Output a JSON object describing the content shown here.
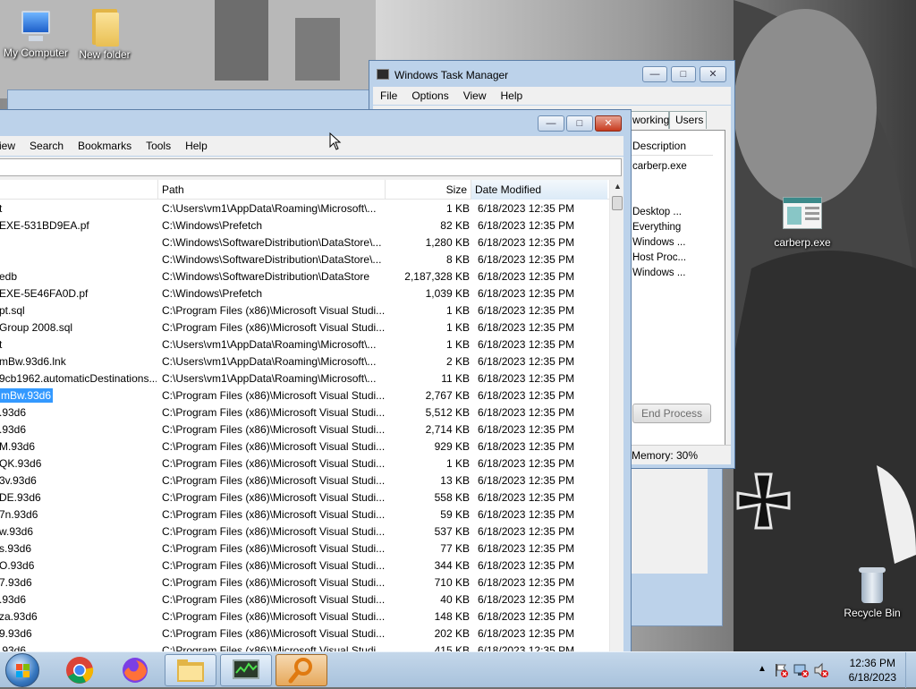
{
  "desktop": {
    "icons": [
      {
        "label": "My Computer",
        "icon": "computer-icon"
      },
      {
        "label": "New folder",
        "icon": "folder-icon"
      },
      {
        "label": "carberp.exe",
        "icon": "app-file-icon"
      },
      {
        "label": "Recycle Bin",
        "icon": "recycle-bin-icon"
      }
    ]
  },
  "taskmgr": {
    "title": "Windows Task Manager",
    "menu": [
      "File",
      "Options",
      "View",
      "Help"
    ],
    "tabs": [
      "working",
      "Users"
    ],
    "column_header": "Description",
    "processes": [
      "carberp.exe",
      "Desktop ...",
      "Everything",
      "Windows ...",
      "Host Proc...",
      "Windows ..."
    ],
    "end_process": "End Process",
    "status": "Memory: 30%"
  },
  "everything": {
    "menu": [
      "iew",
      "Search",
      "Bookmarks",
      "Tools",
      "Help"
    ],
    "search_value": "",
    "columns": {
      "path": "Path",
      "size": "Size",
      "date": "Date Modified"
    },
    "rows": [
      {
        "name": "t",
        "path": "C:\\Users\\vm1\\AppData\\Roaming\\Microsoft\\...",
        "size": "1 KB",
        "date": "6/18/2023 12:35 PM"
      },
      {
        "name": "EXE-531BD9EA.pf",
        "path": "C:\\Windows\\Prefetch",
        "size": "82 KB",
        "date": "6/18/2023 12:35 PM"
      },
      {
        "name": "",
        "path": "C:\\Windows\\SoftwareDistribution\\DataStore\\...",
        "size": "1,280 KB",
        "date": "6/18/2023 12:35 PM"
      },
      {
        "name": "",
        "path": "C:\\Windows\\SoftwareDistribution\\DataStore\\...",
        "size": "8 KB",
        "date": "6/18/2023 12:35 PM"
      },
      {
        "name": "edb",
        "path": "C:\\Windows\\SoftwareDistribution\\DataStore",
        "size": "2,187,328 KB",
        "date": "6/18/2023 12:35 PM"
      },
      {
        "name": "EXE-5E46FA0D.pf",
        "path": "C:\\Windows\\Prefetch",
        "size": "1,039 KB",
        "date": "6/18/2023 12:35 PM"
      },
      {
        "name": "pt.sql",
        "path": "C:\\Program Files (x86)\\Microsoft Visual Studi...",
        "size": "1 KB",
        "date": "6/18/2023 12:35 PM"
      },
      {
        "name": "Group 2008.sql",
        "path": "C:\\Program Files (x86)\\Microsoft Visual Studi...",
        "size": "1 KB",
        "date": "6/18/2023 12:35 PM"
      },
      {
        "name": "t",
        "path": "C:\\Users\\vm1\\AppData\\Roaming\\Microsoft\\...",
        "size": "1 KB",
        "date": "6/18/2023 12:35 PM"
      },
      {
        "name": "mBw.93d6.lnk",
        "path": "C:\\Users\\vm1\\AppData\\Roaming\\Microsoft\\...",
        "size": "2 KB",
        "date": "6/18/2023 12:35 PM"
      },
      {
        "name": "9cb1962.automaticDestinations...",
        "path": "C:\\Users\\vm1\\AppData\\Roaming\\Microsoft\\...",
        "size": "11 KB",
        "date": "6/18/2023 12:35 PM"
      },
      {
        "name": "mBw.93d6",
        "path": "C:\\Program Files (x86)\\Microsoft Visual Studi...",
        "size": "2,767 KB",
        "date": "6/18/2023 12:35 PM",
        "selected": true
      },
      {
        "name": ".93d6",
        "path": "C:\\Program Files (x86)\\Microsoft Visual Studi...",
        "size": "5,512 KB",
        "date": "6/18/2023 12:35 PM"
      },
      {
        "name": ".93d6",
        "path": "C:\\Program Files (x86)\\Microsoft Visual Studi...",
        "size": "2,714 KB",
        "date": "6/18/2023 12:35 PM"
      },
      {
        "name": "M.93d6",
        "path": "C:\\Program Files (x86)\\Microsoft Visual Studi...",
        "size": "929 KB",
        "date": "6/18/2023 12:35 PM"
      },
      {
        "name": "QK.93d6",
        "path": "C:\\Program Files (x86)\\Microsoft Visual Studi...",
        "size": "1 KB",
        "date": "6/18/2023 12:35 PM"
      },
      {
        "name": "3v.93d6",
        "path": "C:\\Program Files (x86)\\Microsoft Visual Studi...",
        "size": "13 KB",
        "date": "6/18/2023 12:35 PM"
      },
      {
        "name": "DE.93d6",
        "path": "C:\\Program Files (x86)\\Microsoft Visual Studi...",
        "size": "558 KB",
        "date": "6/18/2023 12:35 PM"
      },
      {
        "name": "7n.93d6",
        "path": "C:\\Program Files (x86)\\Microsoft Visual Studi...",
        "size": "59 KB",
        "date": "6/18/2023 12:35 PM"
      },
      {
        "name": "w.93d6",
        "path": "C:\\Program Files (x86)\\Microsoft Visual Studi...",
        "size": "537 KB",
        "date": "6/18/2023 12:35 PM"
      },
      {
        "name": "s.93d6",
        "path": "C:\\Program Files (x86)\\Microsoft Visual Studi...",
        "size": "77 KB",
        "date": "6/18/2023 12:35 PM"
      },
      {
        "name": "O.93d6",
        "path": "C:\\Program Files (x86)\\Microsoft Visual Studi...",
        "size": "344 KB",
        "date": "6/18/2023 12:35 PM"
      },
      {
        "name": "7.93d6",
        "path": "C:\\Program Files (x86)\\Microsoft Visual Studi...",
        "size": "710 KB",
        "date": "6/18/2023 12:35 PM"
      },
      {
        "name": ".93d6",
        "path": "C:\\Program Files (x86)\\Microsoft Visual Studi...",
        "size": "40 KB",
        "date": "6/18/2023 12:35 PM"
      },
      {
        "name": "za.93d6",
        "path": "C:\\Program Files (x86)\\Microsoft Visual Studi...",
        "size": "148 KB",
        "date": "6/18/2023 12:35 PM"
      },
      {
        "name": "9.93d6",
        "path": "C:\\Program Files (x86)\\Microsoft Visual Studi...",
        "size": "202 KB",
        "date": "6/18/2023 12:35 PM"
      },
      {
        "name": ".93d6",
        "path": "C:\\Program Files (x86)\\Microsoft Visual Studi...",
        "size": "415 KB",
        "date": "6/18/2023 12:35 PM"
      }
    ]
  },
  "taskbar": {
    "pinned": [
      "start-orb",
      "chrome-icon",
      "firefox-icon",
      "explorer-icon",
      "taskmgr-icon",
      "everything-search-icon"
    ],
    "clock_time": "12:36 PM",
    "clock_date": "6/18/2023"
  },
  "colors": {
    "selection": "#3399ff",
    "taskbar": "#b9cfe6",
    "window_frame": "#bcd2ea"
  }
}
